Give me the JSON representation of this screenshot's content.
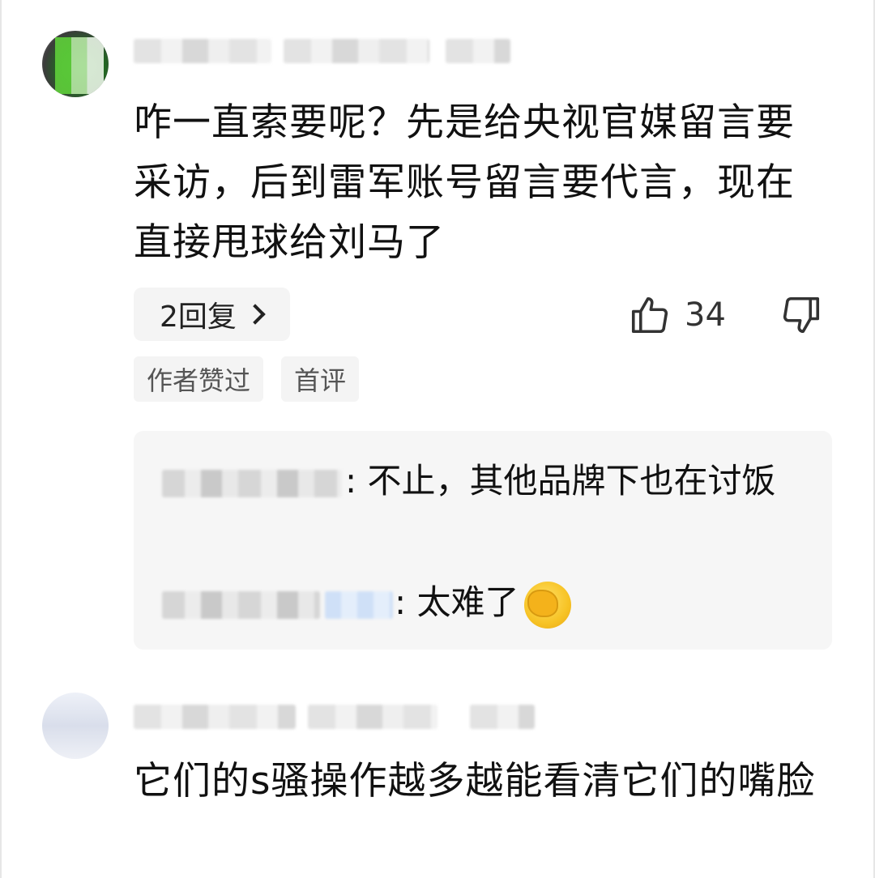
{
  "comments": [
    {
      "text": "咋一直索要呢？先是给央视官媒留言要采访，后到雷军账号留言要代言，现在直接甩球给刘马了",
      "replies_button_label": "2回复",
      "like_count": "34",
      "tags": [
        "作者赞过",
        "首评"
      ],
      "replies": [
        {
          "text": "不止，其他品牌下也在讨饭"
        },
        {
          "text": "太难了"
        }
      ]
    },
    {
      "text": "它们的s骚操作越多越能看清它们的嘴脸"
    }
  ],
  "icons": {
    "like": "thumbs-up-icon",
    "dislike": "thumbs-down-icon",
    "chevron": "chevron-right-icon",
    "emoji": "facepalm-emoji"
  }
}
